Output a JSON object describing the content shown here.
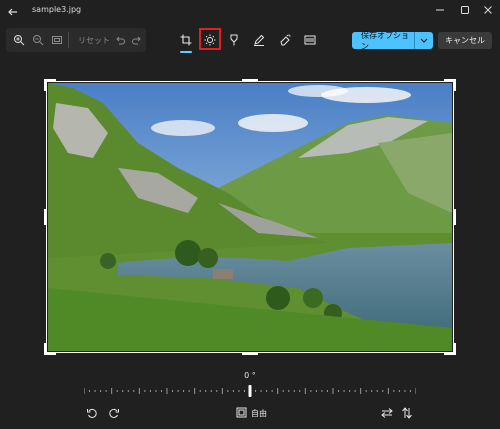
{
  "window": {
    "title": "sample3.jpg",
    "icons": {
      "back": "back-arrow-icon",
      "minimize": "minimize-icon",
      "maximize": "maximize-icon",
      "close": "close-icon"
    }
  },
  "toolbar": {
    "reset_label": "リセット",
    "icons": [
      "zoom-in-icon",
      "zoom-out-icon",
      "fit-view-icon",
      "undo-icon",
      "redo-icon"
    ],
    "tools": [
      "crop-icon",
      "adjustment-icon",
      "filter-icon",
      "markup-icon",
      "erase-icon",
      "background-icon"
    ],
    "active_tool": "crop",
    "highlighted_tool": "adjustment"
  },
  "actions": {
    "save_label": "保存オプション",
    "cancel_label": "キャンセル"
  },
  "crop": {
    "angle_label": "0 °",
    "aspect_label": "自由",
    "rotation_percent": 50
  },
  "colors": {
    "background": "#202020",
    "accent": "#4cc2ff",
    "highlight": "#e02020"
  }
}
